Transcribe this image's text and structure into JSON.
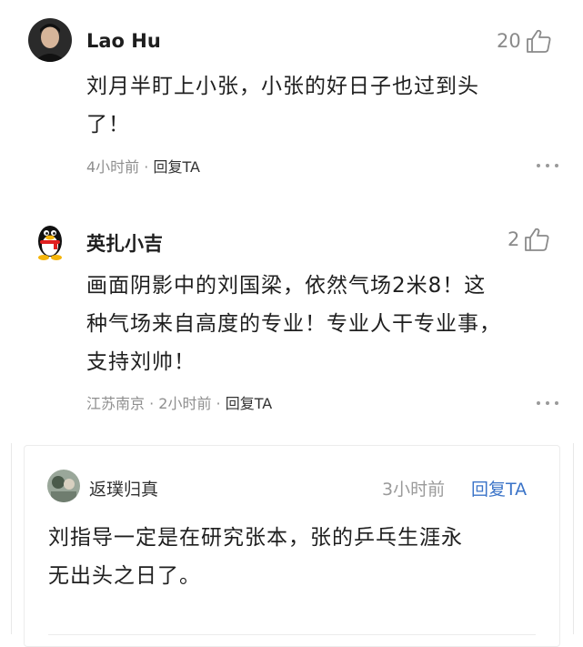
{
  "comments": [
    {
      "user": "Lao Hu",
      "likes": "20",
      "text_line1": "刘月半盯上小张，小张的好日子也过到头",
      "text_line2": "了！",
      "meta_time": "4小时前",
      "meta_sep": " · ",
      "reply": "回复TA",
      "avatar_icon": "user-photo-icon"
    },
    {
      "user": "英扎小吉",
      "likes": "2",
      "text_line1": "画面阴影中的刘国梁，依然气场2米8！这",
      "text_line2": "种气场来自高度的专业！专业人干专业事，",
      "text_line3": "支持刘帅！",
      "meta_location": "江苏南京",
      "meta_time": "2小时前",
      "meta_sep": " · ",
      "reply": "回复TA",
      "avatar_icon": "penguin-icon"
    }
  ],
  "quoted": {
    "user": "返璞归真",
    "time": "3小时前",
    "reply": "回复TA",
    "text_line1": "刘指导一定是在研究张本，张的乒乓生涯永",
    "text_line2": "无出头之日了。",
    "avatar_icon": "user-photo-icon"
  },
  "colors": {
    "link_blue": "#3b74c8",
    "meta_gray": "#8f8f8f"
  }
}
